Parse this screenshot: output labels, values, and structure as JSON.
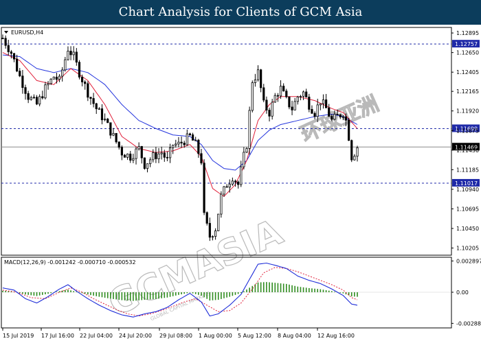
{
  "header": {
    "title": "Chart Analysis for Clients of GCM Asia"
  },
  "watermark": {
    "brand": "GCMASIA",
    "tagline": "GLOBAL CAPITAL MARKETS",
    "chinese": "环球亚洲",
    "color": "#b9b9b9"
  },
  "colors": {
    "background": "#ffffff",
    "header_bg": "#0c3d5c",
    "candles": "#000000",
    "ma_fast": "#e0203a",
    "ma_slow": "#2233dd",
    "hline": "#1f2aa8",
    "macd_hist": "#2e8b1e",
    "macd_line": "#1c2bd8",
    "macd_signal": "#e0203a",
    "price_tag": "#1f2aa8"
  },
  "chart_data": [
    {
      "type": "candlestick",
      "symbol_label": "EURUSD,H4",
      "ylim": [
        1.1015,
        1.1293
      ],
      "y_ticks": [
        "1.12895",
        "1.12650",
        "1.12405",
        "1.12165",
        "1.11920",
        "1.11675",
        "1.11430",
        "1.11185",
        "1.10940",
        "1.10695",
        "1.10450",
        "1.10205"
      ],
      "levels": [
        {
          "value": 1.12757,
          "label": "1.12757",
          "style": "dashed"
        },
        {
          "value": 1.11699,
          "label": "1.11699",
          "style": "dashed"
        },
        {
          "value": 1.11017,
          "label": "1.11017",
          "style": "dashed"
        }
      ],
      "current_price": {
        "value": 1.11469,
        "label": "1.11469"
      },
      "x_labels": [
        "15 Jul 2019",
        "17 Jul 16:00",
        "22 Jul 04:00",
        "24 Jul 20:00",
        "29 Jul 08:00",
        "1 Aug 00:00",
        "5 Aug 12:00",
        "8 Aug 04:00",
        "12 Aug 16:00"
      ],
      "close_path": [
        [
          0,
          1.1283
        ],
        [
          3,
          1.1265
        ],
        [
          6,
          1.1235
        ],
        [
          9,
          1.121
        ],
        [
          12,
          1.12
        ],
        [
          15,
          1.122
        ],
        [
          18,
          1.1235
        ],
        [
          20,
          1.123
        ],
        [
          23,
          1.127
        ],
        [
          25,
          1.126
        ],
        [
          27,
          1.124
        ],
        [
          30,
          1.1215
        ],
        [
          33,
          1.1195
        ],
        [
          36,
          1.118
        ],
        [
          39,
          1.116
        ],
        [
          42,
          1.114
        ],
        [
          45,
          1.1135
        ],
        [
          48,
          1.1145
        ],
        [
          50,
          1.1125
        ],
        [
          53,
          1.1135
        ],
        [
          56,
          1.114
        ],
        [
          58,
          1.113
        ],
        [
          60,
          1.115
        ],
        [
          62,
          1.115
        ],
        [
          64,
          1.1155
        ],
        [
          66,
          1.116
        ],
        [
          68,
          1.115
        ],
        [
          70,
          1.113
        ],
        [
          71,
          1.106
        ],
        [
          73,
          1.1035
        ],
        [
          75,
          1.1045
        ],
        [
          77,
          1.1085
        ],
        [
          79,
          1.11
        ],
        [
          81,
          1.111
        ],
        [
          83,
          1.11
        ],
        [
          85,
          1.1135
        ],
        [
          86,
          1.115
        ],
        [
          87,
          1.119
        ],
        [
          88,
          1.123
        ],
        [
          90,
          1.124
        ],
        [
          92,
          1.12
        ],
        [
          94,
          1.119
        ],
        [
          96,
          1.121
        ],
        [
          98,
          1.122
        ],
        [
          100,
          1.1205
        ],
        [
          102,
          1.1195
        ],
        [
          104,
          1.121
        ],
        [
          106,
          1.1215
        ],
        [
          108,
          1.12
        ],
        [
          110,
          1.119
        ],
        [
          112,
          1.1205
        ],
        [
          114,
          1.1195
        ],
        [
          116,
          1.118
        ],
        [
          118,
          1.1185
        ],
        [
          120,
          1.119
        ],
        [
          121,
          1.118
        ],
        [
          122,
          1.116
        ],
        [
          123,
          1.1135
        ],
        [
          124,
          1.114
        ],
        [
          125,
          1.1147
        ]
      ],
      "ma_fast_path": [
        [
          0,
          1.1265
        ],
        [
          6,
          1.1255
        ],
        [
          12,
          1.123
        ],
        [
          18,
          1.1225
        ],
        [
          24,
          1.1245
        ],
        [
          30,
          1.123
        ],
        [
          36,
          1.12
        ],
        [
          42,
          1.116
        ],
        [
          48,
          1.1145
        ],
        [
          54,
          1.114
        ],
        [
          60,
          1.1142
        ],
        [
          66,
          1.115
        ],
        [
          70,
          1.1135
        ],
        [
          74,
          1.1095
        ],
        [
          78,
          1.1085
        ],
        [
          82,
          1.11
        ],
        [
          86,
          1.113
        ],
        [
          90,
          1.118
        ],
        [
          94,
          1.12
        ],
        [
          98,
          1.121
        ],
        [
          104,
          1.121
        ],
        [
          110,
          1.1205
        ],
        [
          116,
          1.1195
        ],
        [
          120,
          1.119
        ],
        [
          125,
          1.117
        ]
      ],
      "ma_slow_path": [
        [
          0,
          1.1262
        ],
        [
          6,
          1.126
        ],
        [
          12,
          1.1245
        ],
        [
          18,
          1.124
        ],
        [
          24,
          1.1245
        ],
        [
          30,
          1.124
        ],
        [
          36,
          1.1225
        ],
        [
          42,
          1.12
        ],
        [
          48,
          1.118
        ],
        [
          54,
          1.117
        ],
        [
          60,
          1.1162
        ],
        [
          66,
          1.116
        ],
        [
          70,
          1.115
        ],
        [
          74,
          1.113
        ],
        [
          78,
          1.112
        ],
        [
          82,
          1.1118
        ],
        [
          86,
          1.113
        ],
        [
          90,
          1.1155
        ],
        [
          94,
          1.1168
        ],
        [
          98,
          1.1175
        ],
        [
          104,
          1.118
        ],
        [
          110,
          1.1185
        ],
        [
          116,
          1.1188
        ],
        [
          120,
          1.1185
        ],
        [
          125,
          1.1175
        ]
      ]
    },
    {
      "type": "macd",
      "label": "MACD(12,26,9) -0.001242 -0.000710 -0.000532",
      "ylim": [
        -0.00305,
        0.00305
      ],
      "y_ticks": [
        "0.002897",
        "0.00",
        "-0.002883"
      ],
      "macd_path": [
        [
          0,
          0.0004
        ],
        [
          4,
          0.0002
        ],
        [
          8,
          -0.0006
        ],
        [
          12,
          -0.001
        ],
        [
          16,
          -0.0004
        ],
        [
          20,
          0.0003
        ],
        [
          23,
          0.0007
        ],
        [
          26,
          0.0001
        ],
        [
          30,
          -0.0006
        ],
        [
          34,
          -0.0012
        ],
        [
          38,
          -0.0017
        ],
        [
          42,
          -0.0021
        ],
        [
          46,
          -0.0023
        ],
        [
          50,
          -0.002
        ],
        [
          54,
          -0.0018
        ],
        [
          58,
          -0.0014
        ],
        [
          62,
          -0.0007
        ],
        [
          66,
          -0.0001
        ],
        [
          70,
          -0.0009
        ],
        [
          73,
          -0.0022
        ],
        [
          76,
          -0.002
        ],
        [
          80,
          -0.0012
        ],
        [
          84,
          -0.0002
        ],
        [
          87,
          0.0012
        ],
        [
          90,
          0.0026
        ],
        [
          93,
          0.0027
        ],
        [
          96,
          0.0025
        ],
        [
          100,
          0.0022
        ],
        [
          104,
          0.0015
        ],
        [
          108,
          0.0011
        ],
        [
          112,
          0.0008
        ],
        [
          116,
          0.0003
        ],
        [
          120,
          -0.0003
        ],
        [
          123,
          -0.0011
        ],
        [
          125,
          -0.0012
        ]
      ],
      "signal_path": [
        [
          0,
          0.0002
        ],
        [
          5,
          0.0
        ],
        [
          10,
          -0.0005
        ],
        [
          15,
          -0.0006
        ],
        [
          20,
          0.0
        ],
        [
          24,
          0.0004
        ],
        [
          28,
          0.0
        ],
        [
          32,
          -0.0006
        ],
        [
          36,
          -0.0011
        ],
        [
          40,
          -0.0016
        ],
        [
          44,
          -0.002
        ],
        [
          48,
          -0.0022
        ],
        [
          52,
          -0.002
        ],
        [
          56,
          -0.0017
        ],
        [
          60,
          -0.0013
        ],
        [
          64,
          -0.0009
        ],
        [
          68,
          -0.0006
        ],
        [
          72,
          -0.0012
        ],
        [
          76,
          -0.0018
        ],
        [
          80,
          -0.0017
        ],
        [
          84,
          -0.001
        ],
        [
          88,
          0.0003
        ],
        [
          92,
          0.0018
        ],
        [
          96,
          0.0023
        ],
        [
          100,
          0.0022
        ],
        [
          104,
          0.0019
        ],
        [
          108,
          0.0015
        ],
        [
          112,
          0.0011
        ],
        [
          116,
          0.0007
        ],
        [
          120,
          0.0002
        ],
        [
          123,
          -0.0005
        ],
        [
          125,
          -0.0007
        ]
      ]
    }
  ]
}
